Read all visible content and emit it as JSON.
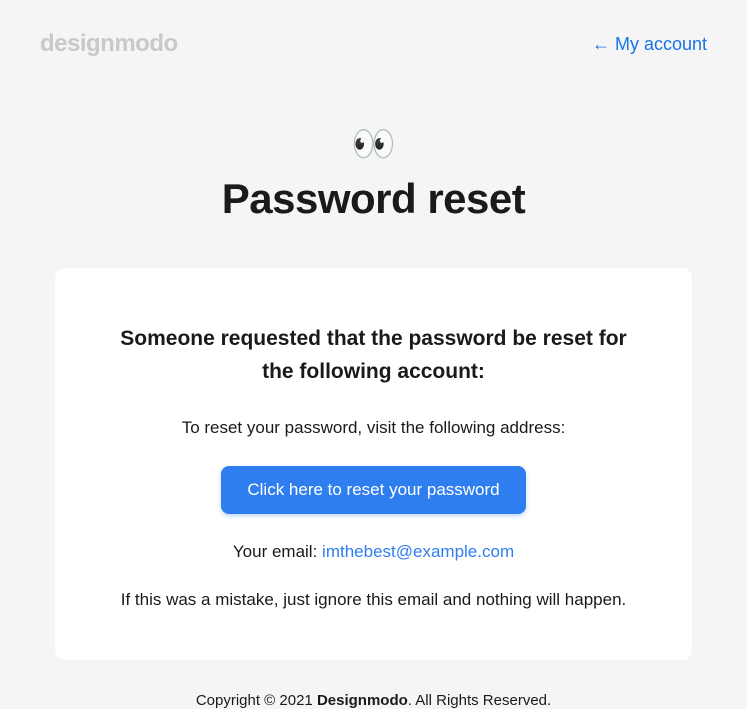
{
  "header": {
    "logo": "designmodo",
    "account_link": "← My account"
  },
  "hero": {
    "icon": "👀",
    "title": "Password reset"
  },
  "card": {
    "heading": "Someone requested that the password be reset for the following account:",
    "instruction": "To reset your password, visit the following address:",
    "button_label": "Click here to reset your password",
    "email_prefix": "Your email: ",
    "email_address": "imthebest@example.com",
    "mistake_text": "If this was a mistake, just ignore this email and nothing will happen."
  },
  "footer": {
    "copyright_prefix": "Copyright © 2021 ",
    "brand": "Designmodo",
    "copyright_suffix": ". All Rights Reserved."
  }
}
